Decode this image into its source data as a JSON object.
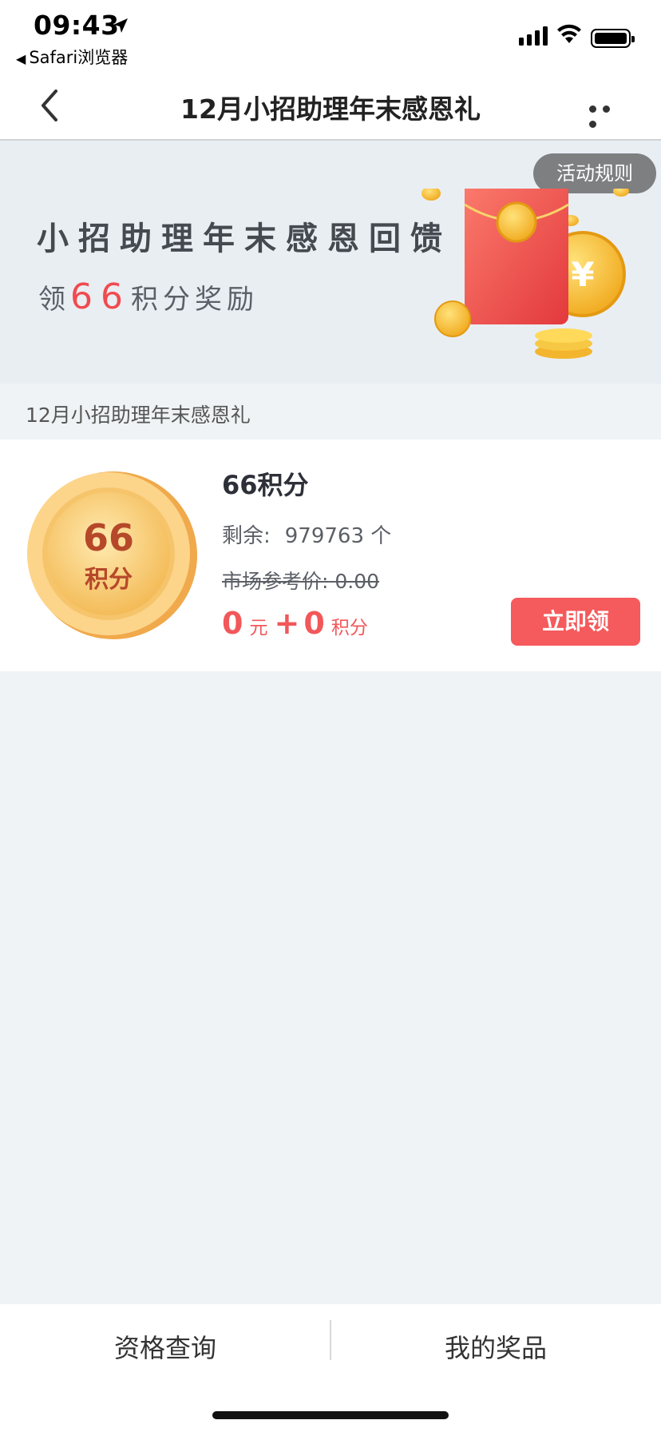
{
  "status_bar": {
    "time": "09:43",
    "back_app": "Safari浏览器",
    "icons": [
      "location-arrow-icon",
      "cellular-signal-icon",
      "wifi-icon",
      "battery-icon"
    ]
  },
  "nav": {
    "title": "12月小招助理年末感恩礼",
    "icons": [
      "back-chevron-icon",
      "more-icon"
    ]
  },
  "banner": {
    "rules_label": "活动规则",
    "title": "小招助理年末感恩回馈",
    "sub_prefix": "领",
    "sub_number": "66",
    "sub_suffix": "积分奖励",
    "accent_color": "#f04b4f"
  },
  "section": {
    "header": "12月小招助理年末感恩礼"
  },
  "item": {
    "title": "66积分",
    "coin_number": "66",
    "coin_label": "积分",
    "remain_label": "剩余:",
    "remain_value": "979763 个",
    "market_label": "市场参考价:",
    "market_value": "0.00",
    "price_yuan": "0",
    "price_yuan_unit": "元",
    "price_plus": "+",
    "price_points": "0",
    "price_points_unit": "积分",
    "claim_label": "立即领",
    "price_color": "#f2575a"
  },
  "bottom": {
    "tab_left": "资格查询",
    "tab_right": "我的奖品"
  }
}
